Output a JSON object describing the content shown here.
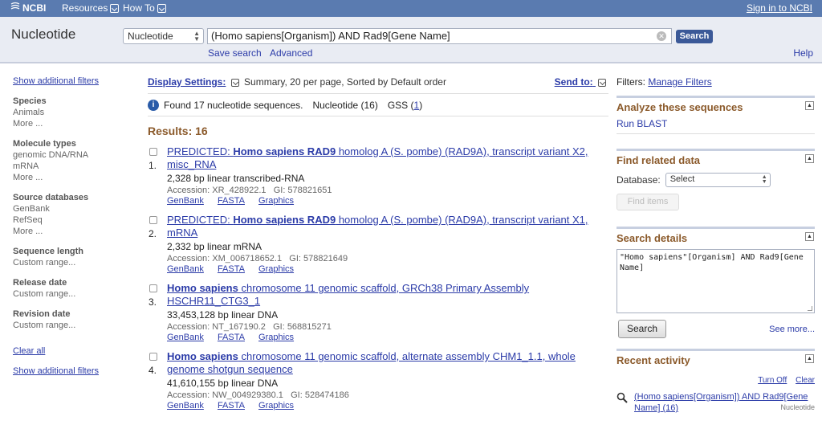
{
  "topbar": {
    "logo": "NCBI",
    "resources": "Resources",
    "howto": "How To",
    "signin": "Sign in to NCBI"
  },
  "search": {
    "db_name": "Nucleotide",
    "db_select": "Nucleotide",
    "query": "(Homo sapiens[Organism]) AND Rad9[Gene Name]",
    "button": "Search",
    "save_search": "Save search",
    "advanced": "Advanced",
    "help": "Help"
  },
  "left": {
    "show_filters_top": "Show additional filters",
    "groups": [
      {
        "title": "Species",
        "items": [
          "Animals"
        ],
        "more": "More ..."
      },
      {
        "title": "Molecule types",
        "items": [
          "genomic DNA/RNA",
          "mRNA"
        ],
        "more": "More ..."
      },
      {
        "title": "Source databases",
        "items": [
          "GenBank",
          "RefSeq"
        ],
        "more": "More ..."
      },
      {
        "title": "Sequence length",
        "items": [
          "Custom range..."
        ]
      },
      {
        "title": "Release date",
        "items": [
          "Custom range..."
        ]
      },
      {
        "title": "Revision date",
        "items": [
          "Custom range..."
        ]
      }
    ],
    "clear_all": "Clear all",
    "show_filters_bottom": "Show additional filters"
  },
  "main": {
    "display_settings": "Display Settings:",
    "display_summary": "Summary, 20 per page, Sorted by Default order",
    "send_to": "Send to:",
    "found_text": "Found 17 nucleotide sequences.",
    "found_nuc": "Nucleotide (16)",
    "found_gss_label": "GSS (",
    "found_gss_count": "1",
    "found_gss_close": ")",
    "results_count": "Results: 16",
    "results": [
      {
        "number": "1.",
        "title_prefix": "PREDICTED: ",
        "title_bold": "Homo sapiens RAD9",
        "title_rest": " homolog A (S. pombe) (RAD9A), transcript variant X2, misc_RNA",
        "desc": "2,328 bp linear transcribed-RNA",
        "accession": "Accession: XR_428922.1",
        "gi": "GI: 578821651",
        "links": [
          "GenBank",
          "FASTA",
          "Graphics"
        ]
      },
      {
        "number": "2.",
        "title_prefix": "PREDICTED: ",
        "title_bold": "Homo sapiens RAD9",
        "title_rest": " homolog A (S. pombe) (RAD9A), transcript variant X1, mRNA",
        "desc": "2,332 bp linear mRNA",
        "accession": "Accession: XM_006718652.1",
        "gi": "GI: 578821649",
        "links": [
          "GenBank",
          "FASTA",
          "Graphics"
        ]
      },
      {
        "number": "3.",
        "title_prefix": "",
        "title_bold": "Homo sapiens",
        "title_rest": " chromosome 11 genomic scaffold, GRCh38 Primary Assembly HSCHR11_CTG3_1",
        "desc": "33,453,128 bp linear DNA",
        "accession": "Accession: NT_167190.2",
        "gi": "GI: 568815271",
        "links": [
          "GenBank",
          "FASTA",
          "Graphics"
        ]
      },
      {
        "number": "4.",
        "title_prefix": "",
        "title_bold": "Homo sapiens",
        "title_rest": " chromosome 11 genomic scaffold, alternate assembly CHM1_1.1, whole genome shotgun sequence",
        "desc": "41,610,155 bp linear DNA",
        "accession": "Accession: NW_004929380.1",
        "gi": "GI: 528474186",
        "links": [
          "GenBank",
          "FASTA",
          "Graphics"
        ]
      }
    ]
  },
  "right": {
    "filters_label": "Filters:",
    "manage_filters": "Manage Filters",
    "analyze_title": "Analyze these sequences",
    "run_blast": "Run BLAST",
    "related_title": "Find related data",
    "database_label": "Database:",
    "database_select": "Select",
    "find_items": "Find items",
    "details_title": "Search details",
    "details_query": "\"Homo sapiens\"[Organism] AND Rad9[Gene Name]",
    "details_search": "Search",
    "see_more": "See more...",
    "recent_title": "Recent activity",
    "turn_off": "Turn Off",
    "clear": "Clear",
    "recent_item": "(Homo sapiens[Organism]) AND Rad9[Gene Name] (16)",
    "recent_db": "Nucleotide"
  }
}
